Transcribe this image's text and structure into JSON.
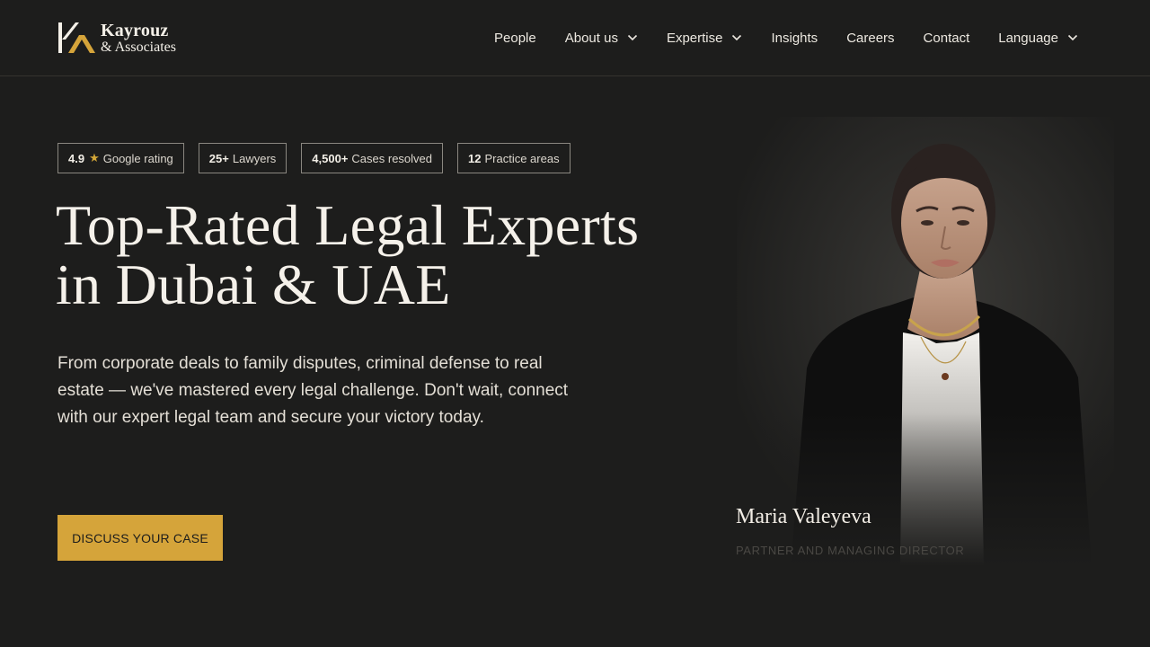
{
  "brand": {
    "name_line1": "Kayrouz",
    "name_line2": "& Associates",
    "accent_color": "#d5a43a"
  },
  "nav": {
    "items": [
      {
        "label": "People",
        "has_dropdown": false
      },
      {
        "label": "About us",
        "has_dropdown": true
      },
      {
        "label": "Expertise",
        "has_dropdown": true
      },
      {
        "label": "Insights",
        "has_dropdown": false
      },
      {
        "label": "Careers",
        "has_dropdown": false
      },
      {
        "label": "Contact",
        "has_dropdown": false
      },
      {
        "label": "Language",
        "has_dropdown": true
      }
    ]
  },
  "stats": [
    {
      "value": "4.9",
      "label": "Google rating",
      "icon": "star-icon"
    },
    {
      "value": "25+",
      "label": "Lawyers"
    },
    {
      "value": "4,500+",
      "label": "Cases resolved"
    },
    {
      "value": "12",
      "label": "Practice areas"
    }
  ],
  "hero": {
    "headline_line1": "Top-Rated Legal Experts",
    "headline_line2": "in Dubai & UAE",
    "lead": "From corporate deals to family disputes, criminal defense to real estate — we've mastered every legal challenge. Don't wait, connect with our expert legal team and secure your victory today.",
    "cta_label": "DISCUSS YOUR CASE"
  },
  "featured_person": {
    "name": "Maria Valeyeva",
    "role": "PARTNER AND MANAGING DIRECTOR"
  }
}
